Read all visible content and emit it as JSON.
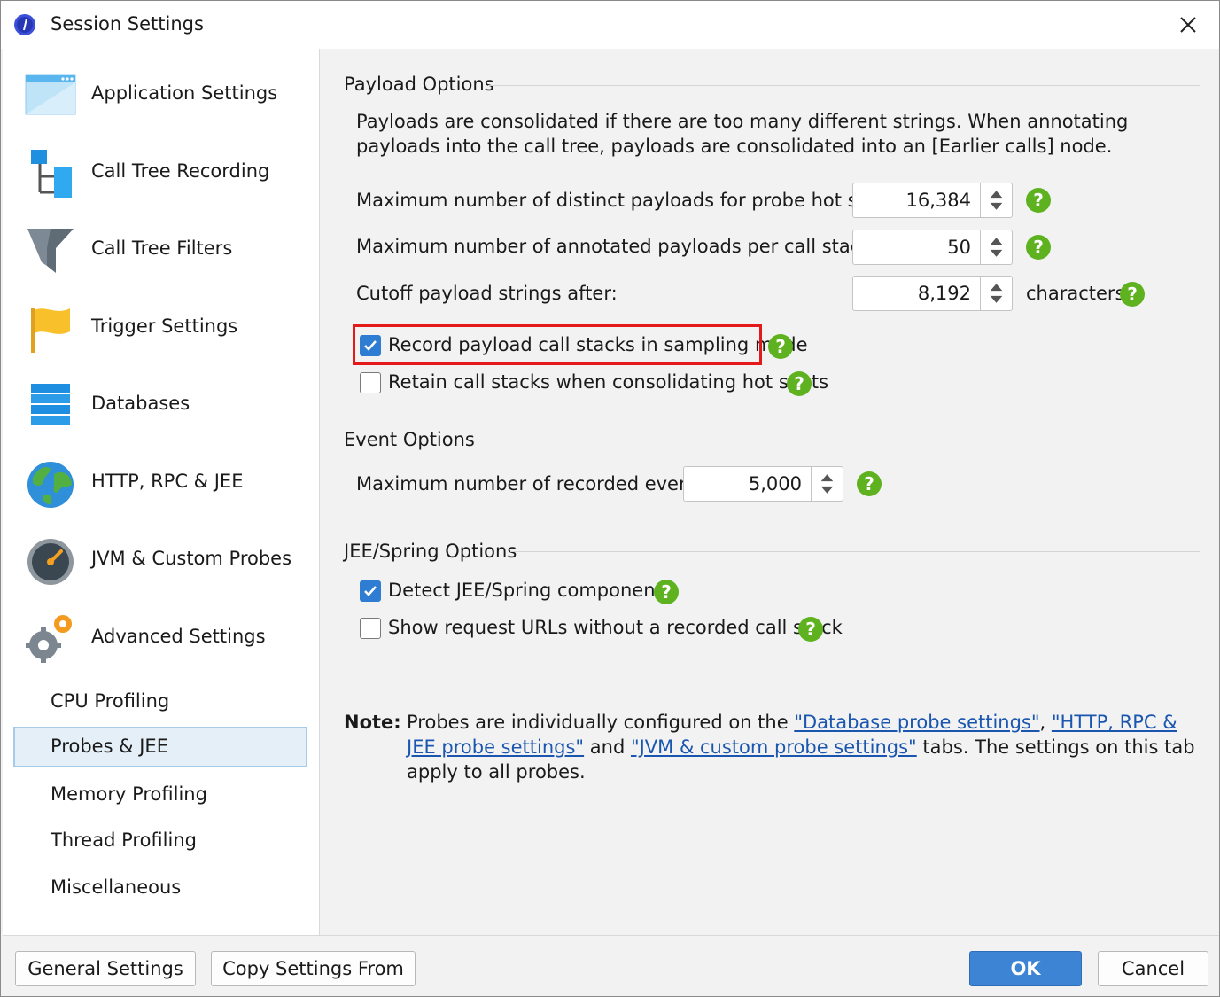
{
  "window": {
    "title": "Session Settings",
    "app_icon": "jprofiler-icon",
    "close_icon": "close-icon"
  },
  "sidebar": {
    "items": [
      {
        "label": "Application Settings",
        "icon": "window-icon"
      },
      {
        "label": "Call Tree Recording",
        "icon": "tree-icon"
      },
      {
        "label": "Call Tree Filters",
        "icon": "funnel-icon"
      },
      {
        "label": "Trigger Settings",
        "icon": "flag-icon"
      },
      {
        "label": "Databases",
        "icon": "database-icon"
      },
      {
        "label": "HTTP, RPC & JEE",
        "icon": "globe-icon"
      },
      {
        "label": "JVM & Custom Probes",
        "icon": "gauge-icon"
      },
      {
        "label": "Advanced Settings",
        "icon": "gears-icon"
      }
    ],
    "sub_items": [
      {
        "label": "CPU Profiling",
        "selected": false
      },
      {
        "label": "Probes & JEE",
        "selected": true
      },
      {
        "label": "Memory Profiling",
        "selected": false
      },
      {
        "label": "Thread Profiling",
        "selected": false
      },
      {
        "label": "Miscellaneous",
        "selected": false
      }
    ]
  },
  "payload": {
    "title": "Payload Options",
    "description": "Payloads are consolidated if there are too many different strings. When annotating payloads into the call tree, payloads are consolidated into an [Earlier calls] node.",
    "max_distinct_label": "Maximum number of distinct payloads for probe hot spots:",
    "max_distinct_value": "16,384",
    "max_annotated_label": "Maximum number of annotated payloads per call stack:",
    "max_annotated_value": "50",
    "cutoff_label": "Cutoff payload strings after:",
    "cutoff_value": "8,192",
    "cutoff_unit": "characters",
    "record_stacks_label": "Record payload call stacks in sampling mode",
    "record_stacks_checked": true,
    "retain_stacks_label": "Retain call stacks when consolidating hot spots",
    "retain_stacks_checked": false
  },
  "events": {
    "title": "Event Options",
    "max_events_label": "Maximum number of recorded events:",
    "max_events_value": "5,000"
  },
  "jee": {
    "title": "JEE/Spring Options",
    "detect_label": "Detect JEE/Spring components",
    "detect_checked": true,
    "show_urls_label": "Show request URLs without a recorded call stack",
    "show_urls_checked": false
  },
  "note": {
    "label": "Note:",
    "text_1": "Probes are individually configured on the ",
    "link_1": "\"Database probe settings\"",
    "sep_1": ", ",
    "link_2": "\"HTTP, RPC & JEE probe settings\"",
    "text_2": " and ",
    "link_3": "\"JVM & custom probe settings\"",
    "text_3": " tabs. The settings on this tab apply to all probes."
  },
  "help_icon": "?",
  "footer": {
    "general_settings": "General Settings",
    "copy_settings": "Copy Settings From",
    "ok": "OK",
    "cancel": "Cancel"
  },
  "colors": {
    "accent": "#3d84d4",
    "checkbox": "#2f7dd2",
    "help": "#5eb21f",
    "highlight": "#e41a1a",
    "link": "#1a56b0"
  }
}
